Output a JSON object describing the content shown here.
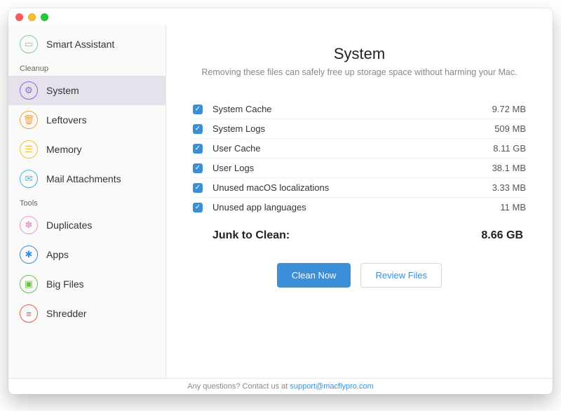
{
  "sidebar": {
    "top": {
      "label": "Smart Assistant",
      "icon": "laptop",
      "color": "#7ecb8f"
    },
    "sections": [
      {
        "title": "Cleanup",
        "items": [
          {
            "label": "System",
            "icon": "gear",
            "color": "#8d67d6",
            "selected": true
          },
          {
            "label": "Leftovers",
            "icon": "trash",
            "color": "#f2a23a"
          },
          {
            "label": "Memory",
            "icon": "layers",
            "color": "#f2c23a"
          },
          {
            "label": "Mail Attachments",
            "icon": "mail",
            "color": "#3bbad6"
          }
        ]
      },
      {
        "title": "Tools",
        "items": [
          {
            "label": "Duplicates",
            "icon": "sparkle",
            "color": "#e49ad6"
          },
          {
            "label": "Apps",
            "icon": "wrench",
            "color": "#3a8fd8"
          },
          {
            "label": "Big Files",
            "icon": "box",
            "color": "#6fbf4b"
          },
          {
            "label": "Shredder",
            "icon": "shred",
            "color": "#e45b4d"
          }
        ]
      }
    ]
  },
  "main": {
    "title": "System",
    "subtitle": "Removing these files can safely free up storage space without harming your Mac.",
    "items": [
      {
        "name": "System Cache",
        "size": "9.72 MB",
        "checked": true
      },
      {
        "name": "System Logs",
        "size": "509 MB",
        "checked": true
      },
      {
        "name": "User Cache",
        "size": "8.11 GB",
        "checked": true
      },
      {
        "name": "User Logs",
        "size": "38.1 MB",
        "checked": true
      },
      {
        "name": "Unused macOS localizations",
        "size": "3.33 MB",
        "checked": true
      },
      {
        "name": "Unused app languages",
        "size": "11 MB",
        "checked": true
      }
    ],
    "summary_label": "Junk to Clean:",
    "summary_value": "8.66 GB",
    "clean_btn": "Clean Now",
    "review_btn": "Review Files"
  },
  "footer": {
    "text": "Any questions? Contact us at ",
    "link": "support@macflypro.com"
  }
}
